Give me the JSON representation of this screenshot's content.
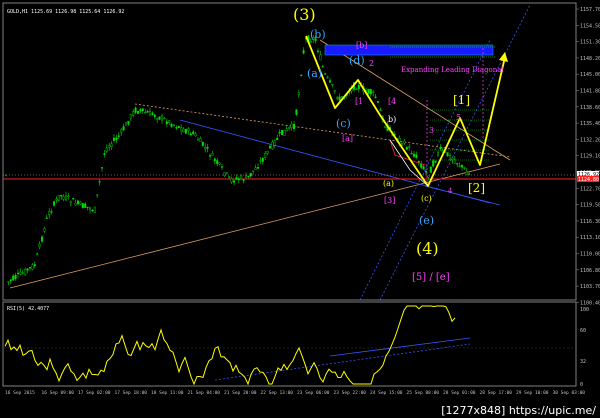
{
  "chart_header": "GOLD,H1  1125.69  1126.98  1125.64  1126.92",
  "price_axis": [
    "1157.70",
    "1154.50",
    "1151.30",
    "1148.20",
    "1145.00",
    "1141.80",
    "1138.60",
    "1135.40",
    "1132.20",
    "1129.10",
    "1125.90",
    "1122.70",
    "1119.50",
    "1116.30",
    "1113.10",
    "1110.00",
    "1106.80",
    "1103.70",
    "1100.40"
  ],
  "current_price": "1126.92",
  "red_line_price": "1124.80",
  "time_axis": [
    "16 Sep 2015",
    "16 Sep 09:00",
    "17 Sep 02:00",
    "17 Sep 18:00",
    "18 Sep 11:00",
    "21 Sep 04:00",
    "21 Sep 20:00",
    "22 Sep 13:00",
    "23 Sep 06:00",
    "23 Sep 22:00",
    "24 Sep 15:00",
    "25 Sep 08:00",
    "28 Sep 01:00",
    "28 Sep 17:00",
    "29 Sep 10:00",
    "30 Sep 03:00"
  ],
  "rsi_header": "RSI(5) 42.4077",
  "rsi_axis": [
    "100",
    "60",
    "32",
    "0"
  ],
  "watermark": "[1277x848] https://upic.me/",
  "wave_labels": {
    "w3": "(3)",
    "b": "(b)",
    "a": "(a)",
    "c": "(c)",
    "d": "(d)",
    "e": "(e)",
    "w4": "(4)",
    "b_box": "[b]",
    "two": "2",
    "a_box": "[a]",
    "one": "[1",
    "four": "[4",
    "b_small": "b)",
    "three": "3",
    "five": "5",
    "one_y": "[1]",
    "two_y": "[2]",
    "a_small": "(a)",
    "c_small": "(c)",
    "three_box": "[3]",
    "four_small": "4",
    "five_e": "[5] / [e]"
  },
  "annotation": "Expanding Leading Diagonal",
  "colors": {
    "candle": "#00e000",
    "wave_yellow": "#ffff00",
    "wave_blue": "#33aaff",
    "magenta": "#ff40ff",
    "red": "#ff2020",
    "blue_box": "#1a1aff"
  }
}
